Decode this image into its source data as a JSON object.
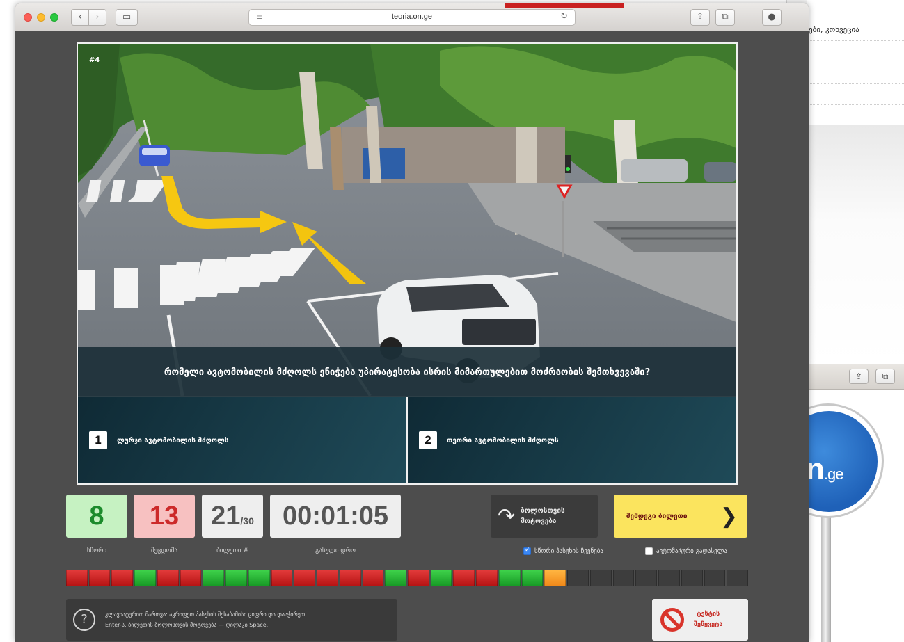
{
  "browser": {
    "url": "teoria.on.ge"
  },
  "background_window": {
    "top_text": "ები, კონვეცია",
    "sign_logo": "n",
    "sign_logo_suffix": ".ge"
  },
  "question": {
    "number": "#4",
    "text": "რომელი ავტომობილის მძღოლს ენიჭება უპირატესობა ისრის მიმართულებით მოძრაობის შემთხვევაში?"
  },
  "answers": [
    {
      "number": "1",
      "text": "ლურჯი ავტომობილის მძღოლს"
    },
    {
      "number": "2",
      "text": "თეთრი ავტომობილის მძღოლს"
    }
  ],
  "stats": {
    "correct": "8",
    "wrong": "13",
    "ticket_current": "21",
    "ticket_total": "/30",
    "time": "00:01:05",
    "correct_label": "სწორი",
    "wrong_label": "შეცდომა",
    "ticket_label": "ბილეთი #",
    "time_label": "გასული დრო"
  },
  "buttons": {
    "back_line1": "ბოლოსთვის",
    "back_line2": "მოტოვება",
    "next": "შემდეგი ბილეთი",
    "close_line1": "ტესტის",
    "close_line2": "შეწყვეტა"
  },
  "checkboxes": {
    "show_correct": "სწორი პასუხის ჩვენება",
    "show_correct_checked": true,
    "auto_next": "ავტომატური გადასვლა",
    "auto_next_checked": false
  },
  "progress": [
    "r",
    "r",
    "r",
    "g",
    "r",
    "r",
    "g",
    "g",
    "g",
    "r",
    "r",
    "r",
    "r",
    "r",
    "g",
    "r",
    "g",
    "r",
    "r",
    "g",
    "g",
    "o",
    "e",
    "e",
    "e",
    "e",
    "e",
    "e",
    "e",
    "e"
  ],
  "hint": {
    "icon": "?",
    "line1": "კლავიატურით მართვა: აკრიფეთ პასუხის შესაბამისი ციფრი და დააჭირეთ",
    "line2": "Enter-ს. ბილეთის ბოლოსთვის მოტოვება — ღილაკი Space."
  }
}
